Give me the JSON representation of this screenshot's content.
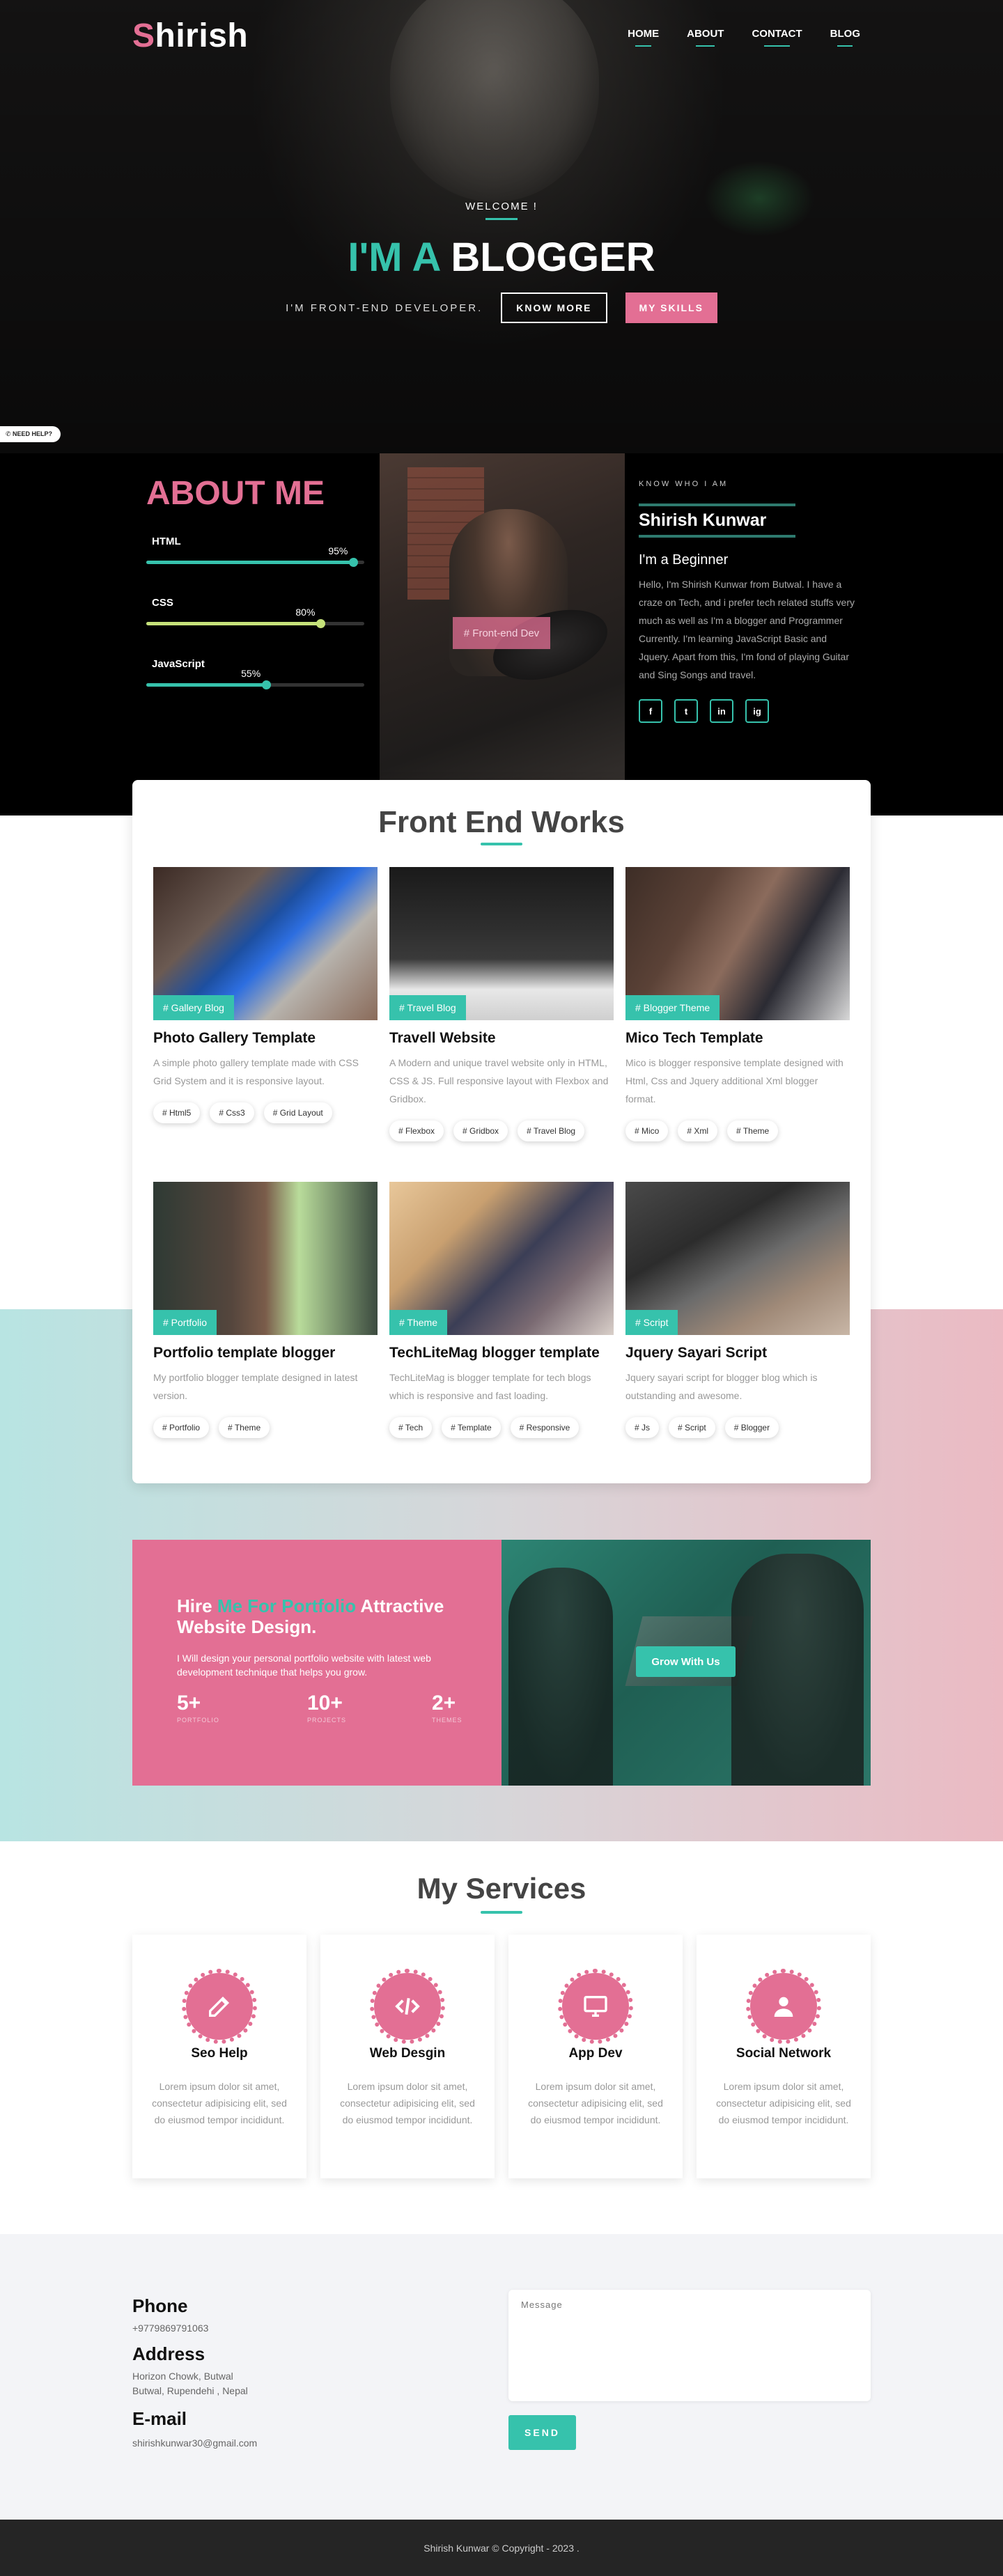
{
  "header": {
    "logo_first": "S",
    "logo_rest": "hirish",
    "nav": [
      "HOME",
      "ABOUT",
      "CONTACT",
      "BLOG"
    ]
  },
  "hero": {
    "welcome": "WELCOME !",
    "title_accent": "I'M A",
    "title_rest": "BLOGGER",
    "subtitle": "I'M FRONT-END DEVELOPER.",
    "know_more": "KNOW MORE",
    "my_skills": "MY SKILLS",
    "need_help": "NEED HELP?"
  },
  "about": {
    "title": "ABOUT ME",
    "skills": [
      {
        "name": "HTML",
        "percent_label": "95%",
        "value": 0.95,
        "color": "#36c2ac"
      },
      {
        "name": "CSS",
        "percent_label": "80%",
        "value": 0.8,
        "color": "#c6e27a"
      },
      {
        "name": "JavaScript",
        "percent_label": "55%",
        "value": 0.55,
        "color": "#36c2ac"
      }
    ],
    "photo_button": "# Front-end Dev",
    "know_label": "KNOW WHO I AM",
    "name": "Shirish Kunwar",
    "role": "I'm a Beginner",
    "description": "Hello, I'm Shirish Kunwar from Butwal. I have a craze on Tech, and i prefer tech related stuffs very much as well as I'm a blogger and Programmer Currently. I'm learning JavaScript Basic and Jquery. Apart from this, I'm fond of playing Guitar and Sing Songs and travel.",
    "social_icons": [
      "facebook-icon",
      "twitter-icon",
      "linkedin-icon",
      "instagram-icon"
    ],
    "social_glyphs": [
      "f",
      "t",
      "in",
      "ig"
    ]
  },
  "works": {
    "title": "Front End Works",
    "items": [
      {
        "tag": "# Gallery Blog",
        "title": "Photo Gallery Template",
        "desc": "A simple photo gallery template made with CSS Grid System and it is responsive layout.",
        "chips": [
          "# Html5",
          "# Css3",
          "# Grid Layout"
        ]
      },
      {
        "tag": "# Travel Blog",
        "title": "Travell Website",
        "desc": "A Modern and unique travel website only in HTML, CSS & JS. Full responsive layout with Flexbox and Gridbox.",
        "chips": [
          "# Flexbox",
          "# Gridbox",
          "# Travel Blog"
        ]
      },
      {
        "tag": "# Blogger Theme",
        "title": "Mico Tech Template",
        "desc": "Mico is blogger responsive template designed with Html, Css and Jquery additional Xml blogger format.",
        "chips": [
          "# Mico",
          "# Xml",
          "# Theme"
        ]
      },
      {
        "tag": "# Portfolio",
        "title": "Portfolio template blogger",
        "desc": "My portfolio blogger template designed in latest version.",
        "chips": [
          "# Portfolio",
          "# Theme"
        ]
      },
      {
        "tag": "# Theme",
        "title": "TechLiteMag blogger template",
        "desc": "TechLiteMag is blogger template for tech blogs which is responsive and fast loading.",
        "chips": [
          "# Tech",
          "# Template",
          "# Responsive"
        ]
      },
      {
        "tag": "# Script",
        "title": "Jquery Sayari Script",
        "desc": "Jquery sayari script for blogger blog which is outstanding and awesome.",
        "chips": [
          "# Js",
          "# Script",
          "# Blogger"
        ]
      }
    ]
  },
  "hire": {
    "title_start": "Hire ",
    "title_accent": "Me For Portfolio",
    "title_end": " Attractive Website Design.",
    "description": "I Will design your personal portfolio website with latest web development technique that helps you grow.",
    "stats": [
      {
        "num": "5+",
        "label": "PORTFOLIO"
      },
      {
        "num": "10+",
        "label": "PROJECTS"
      },
      {
        "num": "2+",
        "label": "THEMES"
      }
    ],
    "button": "Grow With Us"
  },
  "services": {
    "title": "My Services",
    "items": [
      {
        "title": "Seo Help",
        "desc": "Lorem ipsum dolor sit amet, consectetur adipisicing elit, sed do eiusmod tempor incididunt.",
        "icon": "edit-icon"
      },
      {
        "title": "Web Desgin",
        "desc": "Lorem ipsum dolor sit amet, consectetur adipisicing elit, sed do eiusmod tempor incididunt.",
        "icon": "code-icon"
      },
      {
        "title": "App Dev",
        "desc": "Lorem ipsum dolor sit amet, consectetur adipisicing elit, sed do eiusmod tempor incididunt.",
        "icon": "monitor-icon"
      },
      {
        "title": "Social Network",
        "desc": "Lorem ipsum dolor sit amet, consectetur adipisicing elit, sed do eiusmod tempor incididunt.",
        "icon": "user-icon"
      }
    ]
  },
  "contact": {
    "phone_label": "Phone",
    "phone": "+9779869791063",
    "address_label": "Address",
    "address_line1": "Horizon Chowk, Butwal",
    "address_line2": "Butwal, Rupendehi , Nepal",
    "email_label": "E-mail",
    "email": "shirishkunwar30@gmail.com",
    "message_placeholder": "Message",
    "send": "SEND"
  },
  "footer": {
    "copyright": "Shirish Kunwar © Copyright - 2023 ."
  },
  "colors": {
    "accent": "#36c2ac",
    "brand": "#e36f94"
  }
}
